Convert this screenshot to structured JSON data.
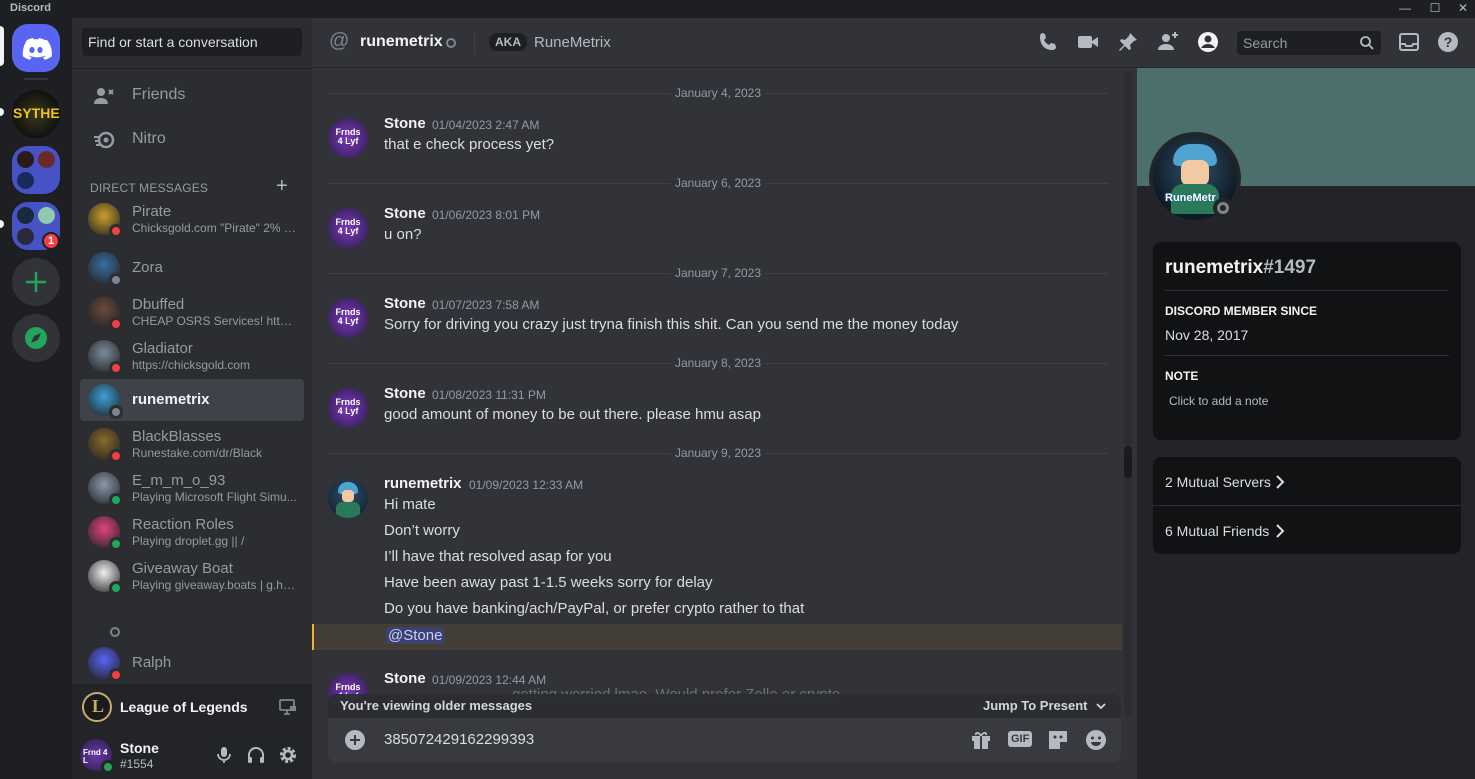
{
  "window": {
    "title": "Discord",
    "controls": [
      "—",
      "☐",
      "✕"
    ]
  },
  "servers": [
    {
      "name": "Home",
      "label": "",
      "badge": ""
    },
    {
      "name": "Sythe",
      "label": "SYTHE",
      "badge": ""
    },
    {
      "name": "Server folder 1",
      "label": "",
      "badge": ""
    },
    {
      "name": "Server folder 2",
      "label": "",
      "badge": "1"
    }
  ],
  "sidebar": {
    "search_placeholder": "Find or start a conversation",
    "nav": [
      {
        "label": "Friends"
      },
      {
        "label": "Nitro"
      }
    ],
    "dm_header": "DIRECT MESSAGES",
    "dm_add": "+",
    "dms": [
      {
        "name": "Pirate",
        "sub": "Chicksgold.com \"Pirate\" 2% of...",
        "status": "dnd",
        "color": "#c9a02e"
      },
      {
        "name": "Zora",
        "sub": "",
        "status": "offline",
        "color": "#3a6f9e"
      },
      {
        "name": "Dbuffed",
        "sub": "CHEAP OSRS Services! https:...",
        "status": "dnd",
        "color": "#6b4a3a"
      },
      {
        "name": "Gladiator",
        "sub": "https://chicksgold.com",
        "status": "dnd",
        "color": "#7a8a9a"
      },
      {
        "name": "runemetrix",
        "sub": "",
        "status": "offline",
        "color": "#3d9fd6"
      },
      {
        "name": "BlackBlasses",
        "sub": "Runestake.com/dr/Black",
        "status": "dnd",
        "color": "#8a6a2a"
      },
      {
        "name": "E_m_m_o_93",
        "sub": "Playing Microsoft Flight Simu...",
        "status": "online",
        "color": "#8a9aa8"
      },
      {
        "name": "Reaction Roles",
        "sub": "Playing droplet.gg || /",
        "status": "online",
        "color": "#e0457b"
      },
      {
        "name": "Giveaway Boat",
        "sub": "Playing giveaway.boats | g.help",
        "status": "online",
        "color": "#f0f0f0"
      },
      {
        "name": "Ralph",
        "sub": "",
        "status": "dnd",
        "color": "#5865f2"
      }
    ],
    "activity": {
      "game": "League of Legends"
    },
    "user": {
      "name": "Stone",
      "tag": "#1554"
    }
  },
  "header": {
    "at": "@",
    "name": "runemetrix",
    "aka_label": "AKA",
    "aka_value": "RuneMetrix",
    "search_placeholder": "Search"
  },
  "messages": {
    "dates": [
      "January 4, 2023",
      "January 6, 2023",
      "January 7, 2023",
      "January 8, 2023",
      "January 9, 2023"
    ],
    "groups": [
      {
        "author": "Stone",
        "time": "01/04/2023 2:47 AM",
        "lines": [
          "that e check process yet?"
        ]
      },
      {
        "author": "Stone",
        "time": "01/06/2023 8:01 PM",
        "lines": [
          "u on?"
        ]
      },
      {
        "author": "Stone",
        "time": "01/07/2023 7:58 AM",
        "lines": [
          "Sorry for driving you crazy  just tryna finish this shit. Can you send me the money today"
        ]
      },
      {
        "author": "Stone",
        "time": "01/08/2023 11:31 PM",
        "lines": [
          "good amount of money to be out there.  please hmu asap"
        ]
      },
      {
        "author": "runemetrix",
        "time": "01/09/2023 12:33 AM",
        "lines": [
          "Hi mate",
          "Don’t worry",
          "I’ll have that resolved asap for you",
          "Have been away past 1-1.5 weeks sorry for delay",
          "Do you have banking/ach/PayPal, or prefer crypto rather to that"
        ]
      },
      {
        "author": "Stone",
        "time": "01/09/2023 12:44 AM",
        "lines": [
          "getting worried lmao. Would prefer Zelle or crypto"
        ]
      }
    ],
    "mention": "@Stone",
    "avatar_text": "Frnds 4 Lyf"
  },
  "older_bar": {
    "text": "You're viewing older messages",
    "jump": "Jump To Present"
  },
  "composer": {
    "value": "385072429162299393",
    "gif": "GIF"
  },
  "profile": {
    "username": "runemetrix",
    "discriminator": "#1497",
    "member_since_label": "DISCORD MEMBER SINCE",
    "member_since": "Nov 28, 2017",
    "note_label": "NOTE",
    "note_placeholder": "Click to add a note",
    "mutual_servers": "2 Mutual Servers",
    "mutual_friends": "6 Mutual Friends",
    "avatar_label": "RuneMetr"
  },
  "colors": {
    "blurple": "#5865f2",
    "green": "#23a55a",
    "red": "#f23f43",
    "banner": "#4b6f6d"
  }
}
